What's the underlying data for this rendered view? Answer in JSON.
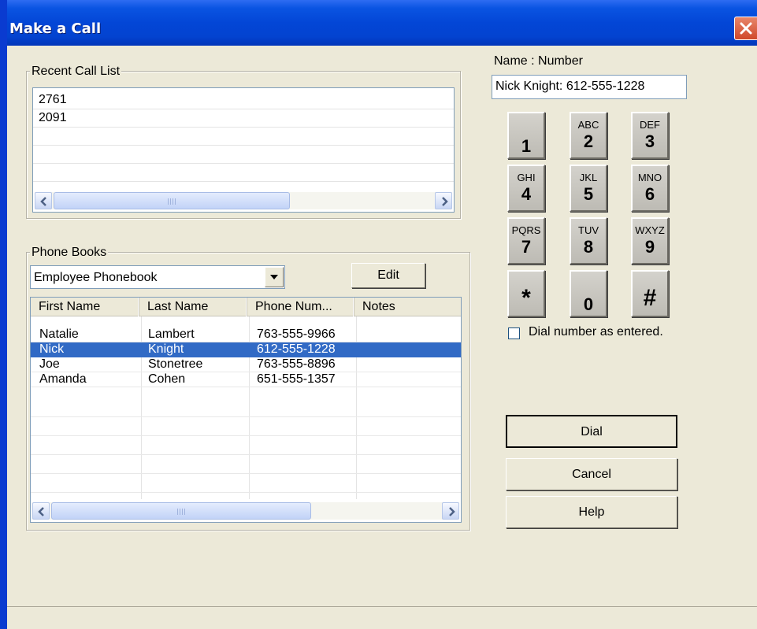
{
  "window": {
    "title": "Make a Call"
  },
  "recent": {
    "legend": "Recent Call List",
    "items": [
      "2761",
      "2091",
      "",
      "",
      ""
    ],
    "scroll_grip": "III"
  },
  "phonebooks": {
    "legend": "Phone Books",
    "selected": "Employee Phonebook",
    "edit_label": "Edit",
    "columns": [
      "First Name",
      "Last Name",
      "Phone Num...",
      "Notes"
    ],
    "rows": [
      [
        "Natalie",
        "Lambert",
        "763-555-9966",
        ""
      ],
      [
        "Nick",
        "Knight",
        "612-555-1228",
        ""
      ],
      [
        "Joe",
        "Stonetree",
        "763-555-8896",
        ""
      ],
      [
        "Amanda",
        "Cohen",
        "651-555-1357",
        ""
      ]
    ],
    "selected_row": 1,
    "scroll_grip": "III"
  },
  "name_number": {
    "label": "Name : Number",
    "value": "Nick Knight: 612-555-1228"
  },
  "keypad": [
    {
      "digit": "1",
      "letters": ""
    },
    {
      "digit": "2",
      "letters": "ABC"
    },
    {
      "digit": "3",
      "letters": "DEF"
    },
    {
      "digit": "4",
      "letters": "GHI"
    },
    {
      "digit": "5",
      "letters": "JKL"
    },
    {
      "digit": "6",
      "letters": "MNO"
    },
    {
      "digit": "7",
      "letters": "PQRS"
    },
    {
      "digit": "8",
      "letters": "TUV"
    },
    {
      "digit": "9",
      "letters": "WXYZ"
    },
    {
      "digit": "*",
      "letters": ""
    },
    {
      "digit": "0",
      "letters": ""
    },
    {
      "digit": "#",
      "letters": ""
    }
  ],
  "dial_as_entered": {
    "label": "Dial number as entered.",
    "checked": false
  },
  "buttons": {
    "dial": "Dial",
    "cancel": "Cancel",
    "help": "Help"
  }
}
